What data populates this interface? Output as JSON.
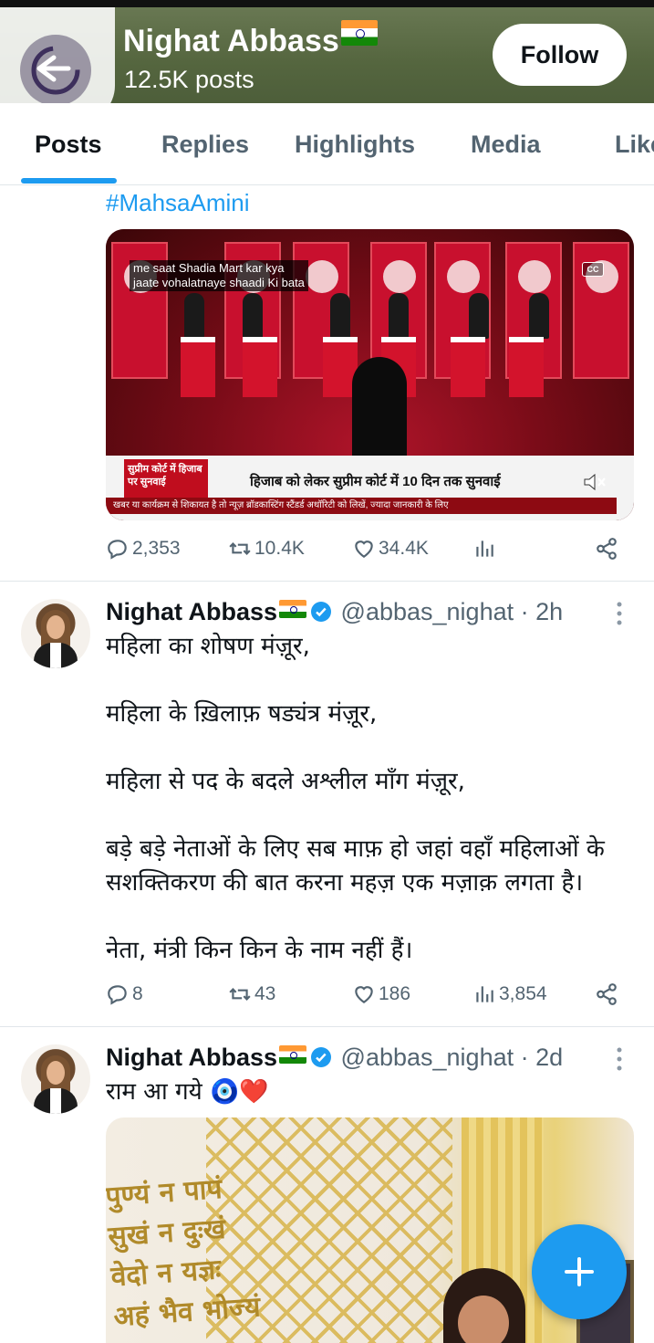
{
  "header": {
    "name": "Nighat Abbass",
    "posts_count": "12.5K posts",
    "follow_label": "Follow",
    "bg_color": "#55663f"
  },
  "tabs": [
    "Posts",
    "Replies",
    "Highlights",
    "Media",
    "Likes"
  ],
  "active_tab": "Posts",
  "tweets": [
    {
      "hashtag": "#MahsaAmini",
      "video": {
        "caption_line1": "me saat Shadia Mart kar kya",
        "caption_line2": "jaate vohalatnaye shaadi Ki bata",
        "cc_label": "CC",
        "lower_third_label": "सुप्रीम कोर्ट में हिजाब पर सुनवाई",
        "headline": "हिजाब को लेकर सुप्रीम कोर्ट में 10 दिन तक सुनवाई",
        "ticker": "खबर या कार्यक्रम से शिकायत है तो न्यूज़ ब्रॉडकास्टिंग स्टैंडर्ड अथॉरिटी को लिखें, ज्यादा जानकारी के लिए"
      },
      "stats": {
        "replies": "2,353",
        "retweets": "10.4K",
        "likes": "34.4K",
        "views": ""
      }
    },
    {
      "name": "Nighat Abbass",
      "handle": "@abbas_nighat · 2h",
      "body": [
        "महिला का शोषण मंज़ूर,",
        "",
        "महिला के ख़िलाफ़ षड्यंत्र मंज़ूर,",
        "",
        "महिला से पद के बदले अश्लील माँग मंज़ूर,",
        "",
        "बड़े बड़े नेताओं के लिए सब माफ़ हो जहां वहाँ महिलाओं के",
        "सशक्तिकरण की बात करना महज़ एक मज़ाक़ लगता है।",
        "",
        "नेता, मंत्री किन किन के नाम नहीं हैं।"
      ],
      "stats": {
        "replies": "8",
        "retweets": "43",
        "likes": "186",
        "views": "3,854"
      }
    },
    {
      "name": "Nighat Abbass",
      "handle": "@abbas_nighat · 2d",
      "body": [
        "राम आ गये 🧿❤️"
      ],
      "image_text": [
        "पुण्यं न पापं",
        "सुखं न दुःखं",
        "वेदो न यज्ञः",
        "अहं भैव भोज्यं"
      ]
    }
  ],
  "colors": {
    "accent": "#1d9bf0",
    "muted": "#536471",
    "text": "#0f1419"
  },
  "icons": [
    "back-arrow-icon",
    "reply-icon",
    "retweet-icon",
    "like-icon",
    "views-icon",
    "share-icon",
    "verified-icon",
    "more-icon",
    "compose-plus-icon",
    "mute-icon"
  ]
}
